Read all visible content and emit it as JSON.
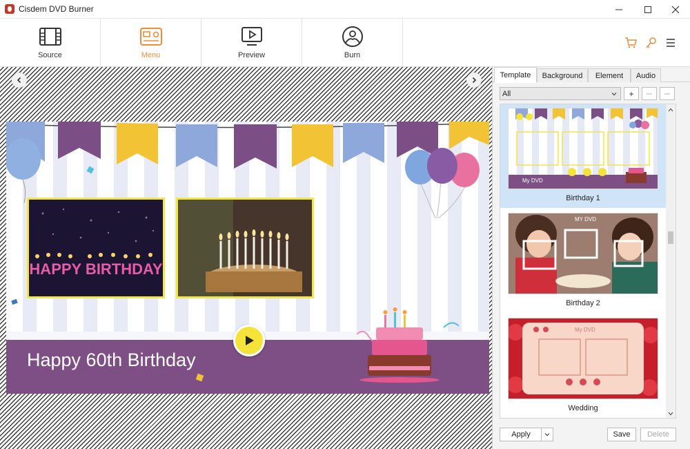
{
  "window": {
    "title": "Cisdem DVD Burner"
  },
  "toolbar": {
    "tabs": [
      {
        "label": "Source",
        "icon": "film-icon"
      },
      {
        "label": "Menu",
        "icon": "menu-layout-icon",
        "active": true
      },
      {
        "label": "Preview",
        "icon": "monitor-play-icon"
      },
      {
        "label": "Burn",
        "icon": "disc-icon"
      }
    ],
    "accent_color": "#ef8b3a"
  },
  "menu_preview": {
    "title": "Happy 60th Birthday",
    "photo1_text": "HAPPY BIRTHDAY",
    "band_color": "#7d4f84"
  },
  "panel": {
    "tabs": [
      "Template",
      "Background",
      "Element",
      "Audio"
    ],
    "filter": {
      "selected": "All"
    },
    "add_label": "+",
    "templates": [
      {
        "label": "Birthday 1",
        "selected": true,
        "thumb_text": "My DVD"
      },
      {
        "label": "Birthday 2",
        "selected": false,
        "thumb_text": "MY DVD"
      },
      {
        "label": "Wedding",
        "selected": false,
        "thumb_text": "My DVD"
      }
    ],
    "buttons": {
      "apply": "Apply",
      "save": "Save",
      "delete": "Delete"
    }
  }
}
